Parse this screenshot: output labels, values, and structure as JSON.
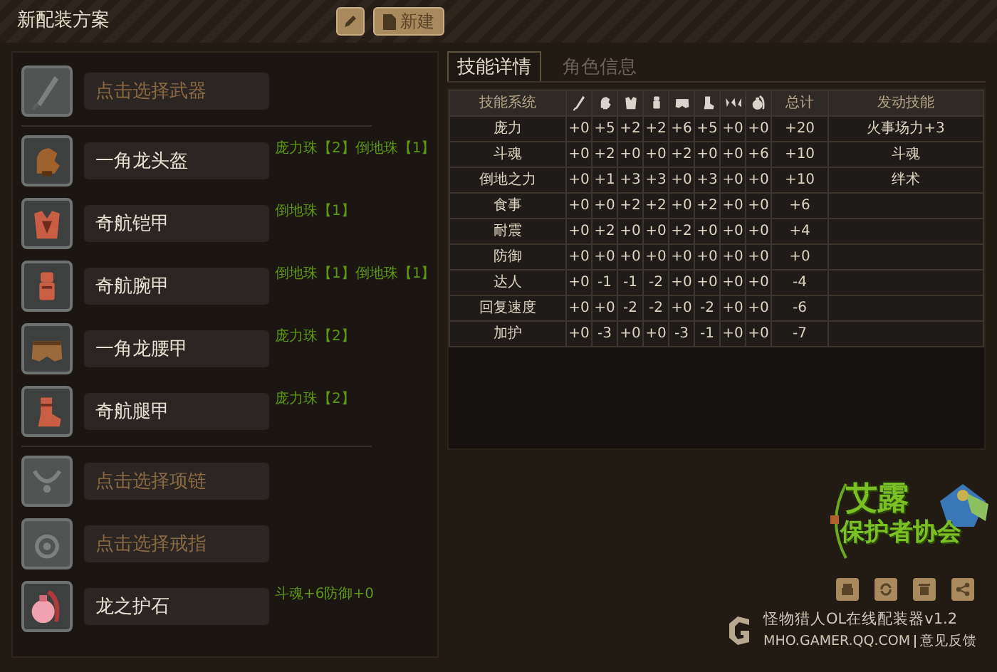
{
  "header": {
    "title": "新配装方案",
    "new_button": "新建"
  },
  "equipment": [
    {
      "kind": "weapon",
      "placeholder": "点击选择武器"
    },
    {
      "kind": "helmet",
      "name": "一角龙头盔",
      "gems": "庞力珠【2】倒地珠【1】"
    },
    {
      "kind": "chest",
      "name": "奇航铠甲",
      "gems": "倒地珠【1】"
    },
    {
      "kind": "arms",
      "name": "奇航腕甲",
      "gems": "倒地珠【1】倒地珠【1】"
    },
    {
      "kind": "waist",
      "name": "一角龙腰甲",
      "gems": "庞力珠【2】"
    },
    {
      "kind": "legs",
      "name": "奇航腿甲",
      "gems": "庞力珠【2】"
    },
    {
      "kind": "necklace",
      "placeholder": "点击选择项链"
    },
    {
      "kind": "ring",
      "placeholder": "点击选择戒指"
    },
    {
      "kind": "charm",
      "name": "龙之护石",
      "gems": "斗魂+6防御+0"
    }
  ],
  "tabs": [
    {
      "label": "技能详情",
      "selected": true
    },
    {
      "label": "角色信息",
      "selected": false
    }
  ],
  "table": {
    "columns": [
      {
        "kind": "text",
        "label": "技能系统"
      },
      {
        "kind": "weapon"
      },
      {
        "kind": "helmet"
      },
      {
        "kind": "chest"
      },
      {
        "kind": "arms"
      },
      {
        "kind": "waist"
      },
      {
        "kind": "legs"
      },
      {
        "kind": "gem"
      },
      {
        "kind": "charm"
      },
      {
        "kind": "text",
        "label": "总计"
      },
      {
        "kind": "text",
        "label": "发动技能"
      }
    ],
    "rows": [
      {
        "skill": "庞力",
        "values": [
          "+0",
          "+5",
          "+2",
          "+2",
          "+6",
          "+5",
          "+0",
          "+0"
        ],
        "total": "+20",
        "activated": "火事场力+3"
      },
      {
        "skill": "斗魂",
        "values": [
          "+0",
          "+2",
          "+0",
          "+0",
          "+2",
          "+0",
          "+0",
          "+6"
        ],
        "total": "+10",
        "activated": "斗魂"
      },
      {
        "skill": "倒地之力",
        "values": [
          "+0",
          "+1",
          "+3",
          "+3",
          "+0",
          "+3",
          "+0",
          "+0"
        ],
        "total": "+10",
        "activated": "绊术"
      },
      {
        "skill": "食事",
        "values": [
          "+0",
          "+0",
          "+2",
          "+2",
          "+0",
          "+2",
          "+0",
          "+0"
        ],
        "total": "+6"
      },
      {
        "skill": "耐震",
        "values": [
          "+0",
          "+2",
          "+0",
          "+0",
          "+2",
          "+0",
          "+0",
          "+0"
        ],
        "total": "+4"
      },
      {
        "skill": "防御",
        "values": [
          "+0",
          "+0",
          "+0",
          "+0",
          "+0",
          "+0",
          "+0",
          "+0"
        ],
        "total": "+0"
      },
      {
        "skill": "达人",
        "values": [
          "+0",
          "-1",
          "-1",
          "-2",
          "+0",
          "+0",
          "+0",
          "+0"
        ],
        "total": "-4"
      },
      {
        "skill": "回复速度",
        "values": [
          "+0",
          "+0",
          "-2",
          "-2",
          "+0",
          "-2",
          "+0",
          "+0"
        ],
        "total": "-6"
      },
      {
        "skill": "加护",
        "values": [
          "+0",
          "-3",
          "+0",
          "+0",
          "-3",
          "-1",
          "+0",
          "+0"
        ],
        "total": "-7"
      }
    ]
  },
  "logo": {
    "line1": "艾露",
    "line2": "保护者协会"
  },
  "footer": {
    "title": "怪物猎人OL在线配装器v1.2",
    "site": "MHO.GAMER.QQ.COM",
    "link": "意见反馈"
  }
}
